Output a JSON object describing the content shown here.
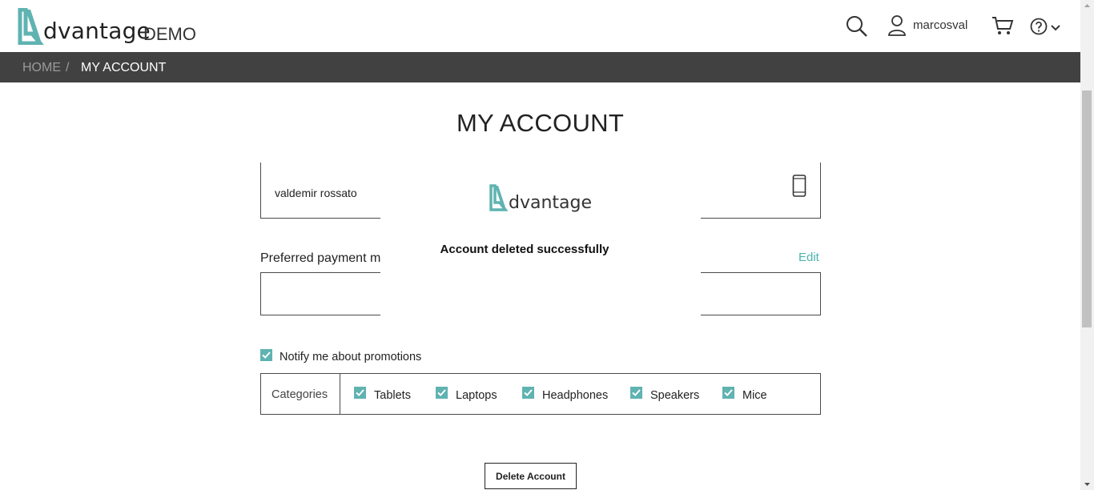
{
  "header": {
    "logo_text": "dvantage",
    "logo_demo": "DEMO",
    "username": "marcosval",
    "icons": [
      "search-icon",
      "user-icon",
      "cart-icon",
      "help-icon",
      "chevron-down-icon"
    ]
  },
  "breadcrumb": {
    "home": "HOME",
    "separator": "/",
    "current": "MY ACCOUNT"
  },
  "page": {
    "title": "MY ACCOUNT"
  },
  "account": {
    "name": "valdemir rossato",
    "preferred_payment_label": "Preferred payment m",
    "edit_label": "Edit"
  },
  "modal": {
    "logo_text": "dvantage",
    "message": "Account deleted successfully"
  },
  "promotions": {
    "notify_label": "Notify me about promotions",
    "notify_checked": true,
    "categories_label": "Categories",
    "categories": [
      {
        "label": "Tablets",
        "checked": true
      },
      {
        "label": "Laptops",
        "checked": true
      },
      {
        "label": "Headphones",
        "checked": true
      },
      {
        "label": "Speakers",
        "checked": true
      },
      {
        "label": "Mice",
        "checked": true
      }
    ]
  },
  "actions": {
    "delete_label": "Delete Account"
  },
  "colors": {
    "accent": "#5fb3b1",
    "link": "#4ab1b0",
    "breadcrumb_bg": "#414141"
  }
}
